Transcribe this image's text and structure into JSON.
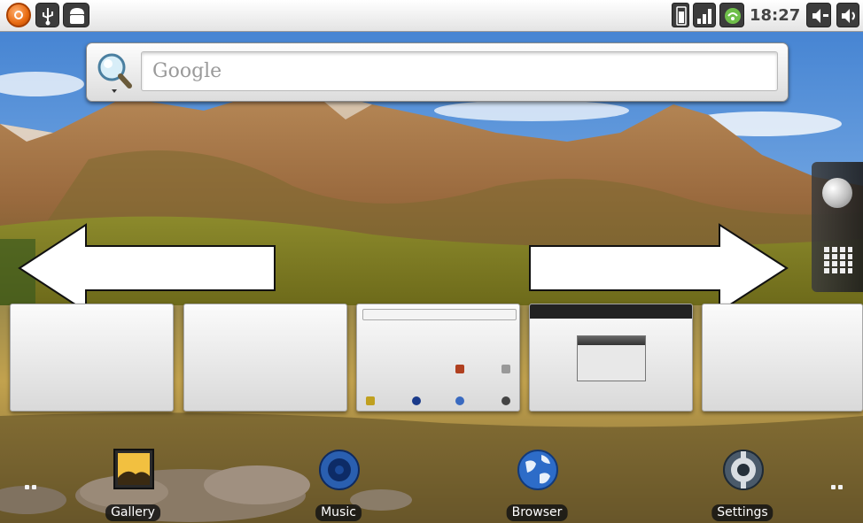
{
  "status_bar": {
    "clock": "18:27",
    "icons": [
      "app-icon",
      "usb-icon",
      "android-icon",
      "battery-icon",
      "signal-icon",
      "wifi-icon",
      "volume-icon",
      "volume-icon"
    ]
  },
  "search_widget": {
    "placeholder": "Google",
    "icon": "search-icon"
  },
  "edge_panel": {
    "icons": [
      "globe-icon",
      "app-drawer-icon"
    ]
  },
  "arrows": {
    "left": "arrow-left-icon",
    "right": "arrow-right-icon"
  },
  "workspaces": {
    "count": 5
  },
  "dock": {
    "items": [
      {
        "label": "Gallery",
        "icon": "gallery-icon"
      },
      {
        "label": "Music",
        "icon": "music-icon"
      },
      {
        "label": "Browser",
        "icon": "browser-icon"
      },
      {
        "label": "Settings",
        "icon": "settings-icon"
      }
    ]
  },
  "colors": {
    "status_bar": "#f0f0f0",
    "dock_label_bg": "#141414",
    "thumb_bg": "#f2f2f2",
    "arrow_fill": "#ffffff"
  }
}
